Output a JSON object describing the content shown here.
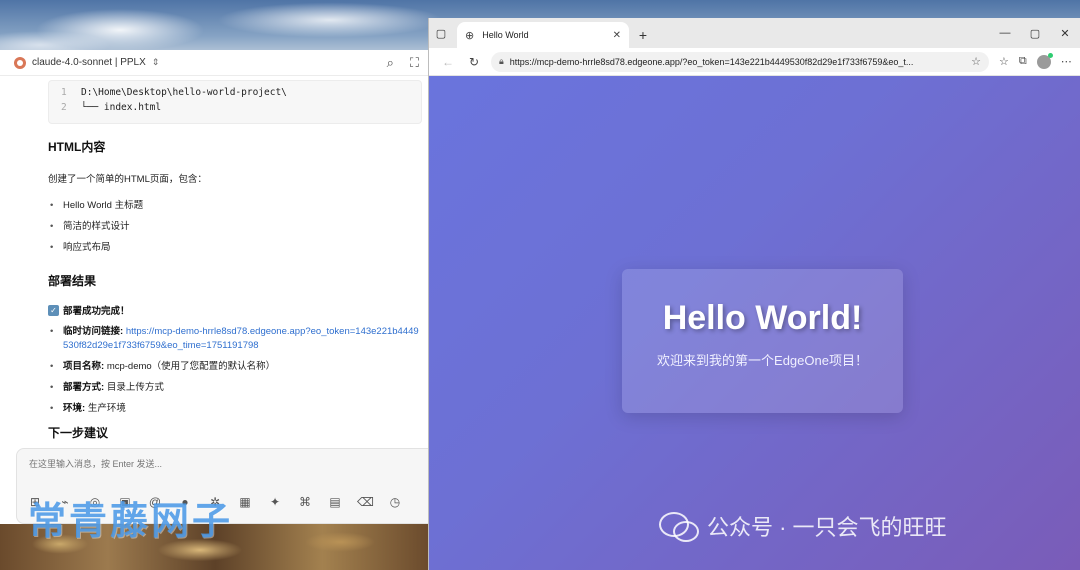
{
  "chat": {
    "model_label": "claude-4.0-sonnet | PPLX",
    "code_lines": [
      {
        "num": "1",
        "text": "D:\\Home\\Desktop\\hello-world-project\\"
      },
      {
        "num": "2",
        "text": "└── index.html"
      }
    ],
    "section_html_title": "HTML内容",
    "html_intro": "创建了一个简单的HTML页面，包含：",
    "html_bullets": [
      "Hello World 主标题",
      "简洁的样式设计",
      "响应式布局"
    ],
    "section_deploy_title": "部署结果",
    "deploy_success": "部署成功完成！",
    "deploy_items": {
      "link_label": "临时访问链接:",
      "link_url": "https://mcp-demo-hrrle8sd78.edgeone.app?eo_token=143e221b4449530f82d29e1f733f6759&eo_time=1751191798",
      "project_label": "项目名称:",
      "project_value": "mcp-demo（使用了您配置的默认名称）",
      "method_label": "部署方式:",
      "method_value": "目录上传方式",
      "env_label": "环境:",
      "env_value": "生产环境"
    },
    "section_next_title": "下一步建议",
    "input_placeholder": "在这里输入消息，按 Enter 发送..."
  },
  "watermark": "常青藤网子",
  "browser": {
    "tab_title": "Hello World",
    "url": "https://mcp-demo-hrrle8sd78.edgeone.app/?eo_token=143e221b4449530f82d29e1f733f6759&eo_t...",
    "page_heading": "Hello World!",
    "page_subtitle": "欢迎来到我的第一个EdgeOne项目！",
    "gradient_colors": [
      "#6a74dd",
      "#7a5cb8"
    ]
  },
  "wechat_watermark": "公众号 · 一只会飞的旺旺"
}
